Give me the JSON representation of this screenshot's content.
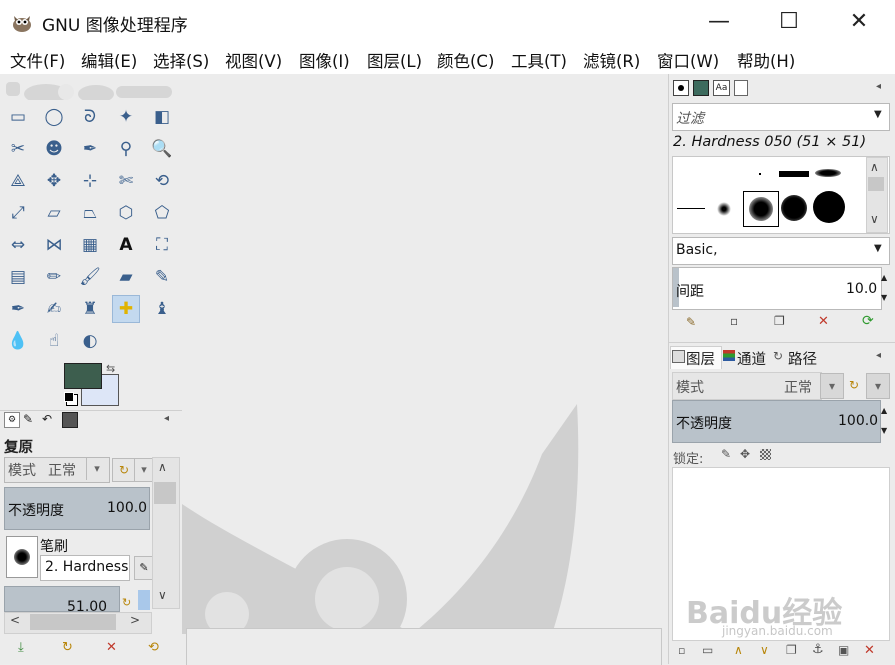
{
  "window": {
    "title": "GNU 图像处理程序",
    "minimize": "—",
    "maximize": "☐",
    "close": "✕"
  },
  "menu": [
    "文件(F)",
    "编辑(E)",
    "选择(S)",
    "视图(V)",
    "图像(I)",
    "图层(L)",
    "颜色(C)",
    "工具(T)",
    "滤镜(R)",
    "窗口(W)",
    "帮助(H)"
  ],
  "colors": {
    "foreground": "#3d5e4e",
    "background": "#dde6f7",
    "accent": "#c3d9ef",
    "slider": "#b9c2ca"
  },
  "tools": [
    "rect-select",
    "ellipse-select",
    "free-select",
    "fuzzy-select",
    "by-color-select",
    "scissors-select",
    "foreground-select",
    "paths",
    "color-picker",
    "zoom",
    "measure",
    "move",
    "align",
    "crop",
    "rotate",
    "scale",
    "shear",
    "perspective",
    "unified-transform",
    "cage-transform",
    "flip",
    "handle-transform",
    "warp",
    "text",
    "bucket-fill",
    "gradient",
    "pencil",
    "paintbrush",
    "eraser",
    "airbrush",
    "ink",
    "mypaint-brush",
    "clone",
    "heal",
    "perspective-clone",
    "blur",
    "smudge",
    "dodge-burn"
  ],
  "active_tool_index": 33,
  "tool_options": {
    "title": "复原",
    "mode_label": "模式",
    "mode_value": "正常",
    "opacity_label": "不透明度",
    "opacity_value": "100.0",
    "brush_label": "笔刷",
    "brush_value": "2. Hardness",
    "size_value": "51.00"
  },
  "brushes": {
    "filter_placeholder": "过滤",
    "selected": "2. Hardness 050 (51 × 51)",
    "preset": "Basic,",
    "spacing_label": "间距",
    "spacing_value": "10.0"
  },
  "layers": {
    "tabs": [
      "图层",
      "通道",
      "路径"
    ],
    "mode_label": "模式",
    "mode_value": "正常",
    "opacity_label": "不透明度",
    "opacity_value": "100.0",
    "lock_label": "锁定:"
  },
  "watermark": {
    "text": "Baidu经验",
    "sub": "jingyan.baidu.com"
  }
}
